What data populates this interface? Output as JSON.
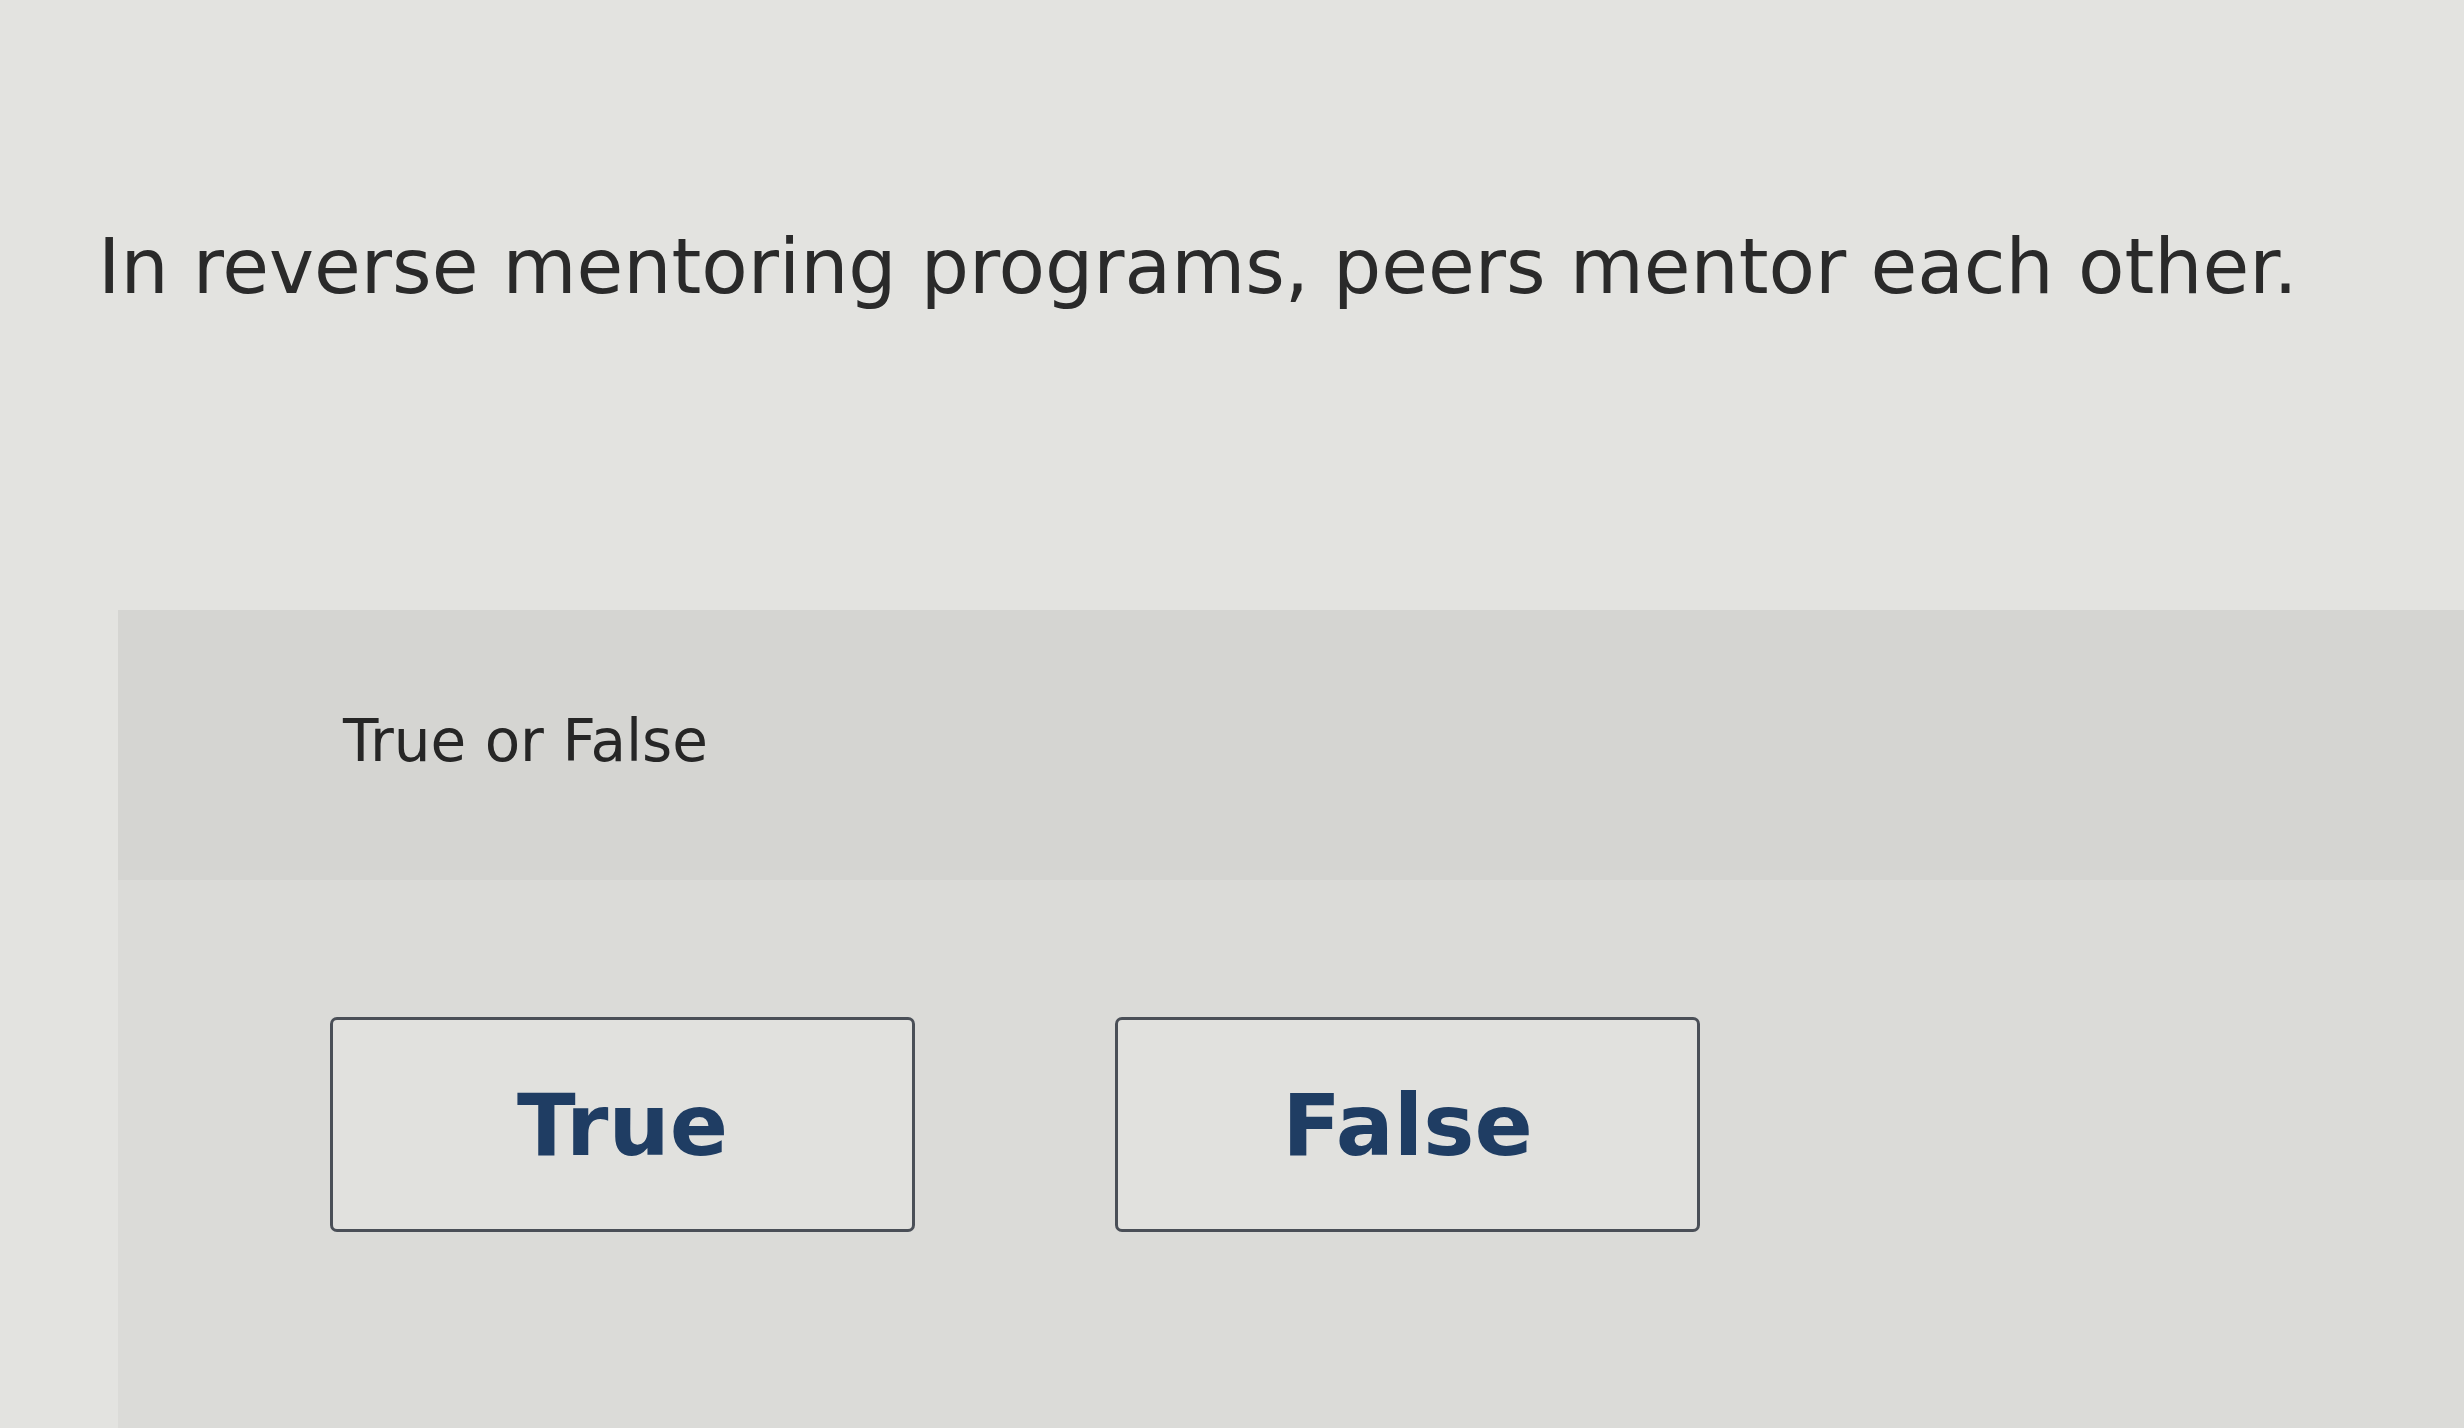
{
  "question": {
    "text": "In reverse mentoring programs, peers mentor each other."
  },
  "answer_panel": {
    "prompt": "True or False",
    "options": [
      {
        "label": "True",
        "selected": false
      },
      {
        "label": "False",
        "selected": false
      }
    ]
  }
}
